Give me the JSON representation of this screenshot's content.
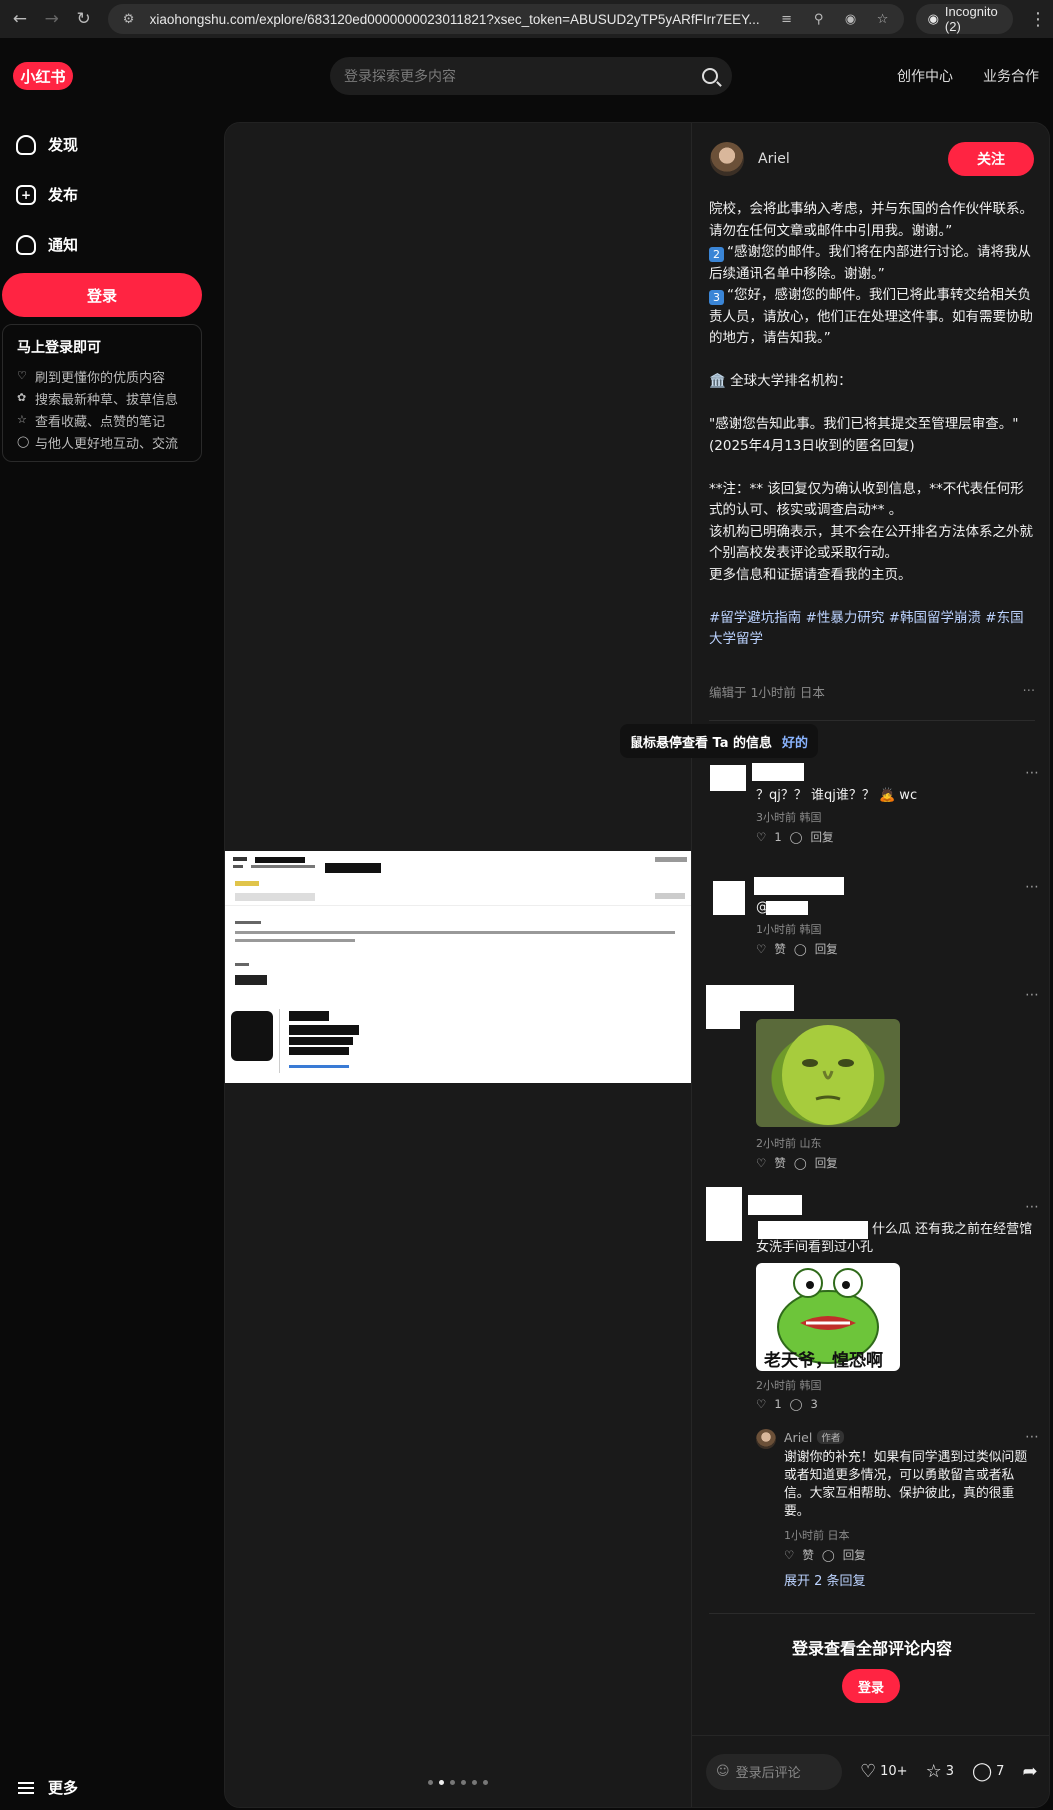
{
  "browser": {
    "url": "xiaohongshu.com/explore/683120ed0000000023011821?xsec_token=ABUSUD2yTP5yARfFIrr7EEY...",
    "incognito_label": "Incognito (2)"
  },
  "header": {
    "logo_text": "小红书",
    "search_placeholder": "登录探索更多内容",
    "links": [
      "创作中心",
      "业务合作"
    ]
  },
  "sidebar": {
    "items": [
      {
        "label": "发现",
        "icon": "home-icon"
      },
      {
        "label": "发布",
        "icon": "plus-square-icon"
      },
      {
        "label": "通知",
        "icon": "bell-icon"
      }
    ],
    "login_button": "登录",
    "login_card": {
      "title": "马上登录即可",
      "items": [
        "刷到更懂你的优质内容",
        "搜索最新种草、拔草信息",
        "查看收藏、点赞的笔记",
        "与他人更好地互动、交流"
      ]
    },
    "more_label": "更多"
  },
  "note": {
    "author": "Ariel",
    "follow_label": "关注",
    "body_lines": [
      "院校，会将此事纳入考虑，并与东国的合作伙伴联系。请勿在任何文章或邮件中引用我。谢谢。”",
      "“感谢您的邮件。我们将在内部进行讨论。请将我从后续通讯名单中移除。谢谢。”",
      "“您好，感谢您的邮件。我们已将此事转交给相关负责人员，请放心，他们正在处理这件事。如有需要协助的地方，请告知我。”",
      "",
      "🏛️ 全球大学排名机构：",
      "",
      "\"感谢您告知此事。我们已将其提交至管理层审查。\"",
      "(2025年4月13日收到的匿名回复)",
      "",
      "**注：** 该回复仅为确认收到信息，**不代表任何形式的认可、核实或调查启动** 。",
      "该机构已明确表示，其不会在公开排名方法体系之外就个别高校发表评论或采取行动。",
      "更多信息和证据请查看我的主页。"
    ],
    "num_badges": [
      "2",
      "3"
    ],
    "tags": "#留学避坑指南 #性暴力研究 #韩国留学崩溃 #东国大学留学",
    "edited": "编辑于 1小时前 日本",
    "image_dots": {
      "count": 6,
      "active": 2
    }
  },
  "tooltip": {
    "text": "鼠标悬停查看 Ta 的信息",
    "action": "好的"
  },
  "comments": [
    {
      "text": "？qj？？ 谁qj谁？？ 🙇 wc",
      "meta": "3小时前 韩国",
      "likes": "1",
      "reply": "回复"
    },
    {
      "text": "@",
      "meta": "1小时前 韩国",
      "likes": "赞",
      "reply": "回复"
    },
    {
      "text": "",
      "meta": "2小时前 山东",
      "likes": "赞",
      "reply": "回复",
      "sticker": "lime-face-sticker"
    },
    {
      "text": "什么瓜 还有我之前在经营馆女洗手间看到过小孔",
      "meta": "2小时前 韩国",
      "likes": "1",
      "reply": "3",
      "sticker": "frog-sticker",
      "sticker_caption": "老天爷，惶恐啊"
    }
  ],
  "reply": {
    "author": "Ariel",
    "author_tag": "作者",
    "text": "谢谢你的补充！如果有同学遇到过类似问题或者知道更多情况，可以勇敢留言或者私信。大家互相帮助、保护彼此，真的很重要。",
    "meta": "1小时前 日本",
    "likes": "赞",
    "reply": "回复",
    "expand": "展开 2 条回复"
  },
  "login_prompt": {
    "title": "登录查看全部评论内容",
    "button": "登录"
  },
  "bottom_bar": {
    "comment_placeholder": "登录后评论",
    "likes": "10+",
    "collects": "3",
    "comments": "7"
  },
  "colors": {
    "brand": "#ff2442",
    "background": "#0a0a0a",
    "panel": "#191919",
    "tag": "#bcd3ff"
  }
}
